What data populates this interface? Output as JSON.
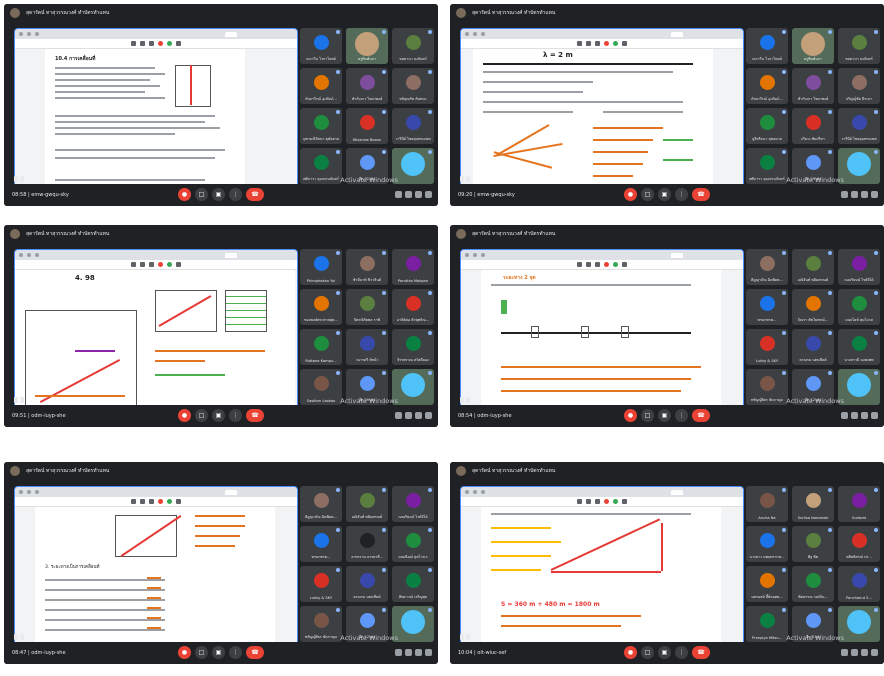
{
  "window_title": "สุดารัตน์ ทาสุวรรณวงศ์ ทำบัตรทำแทน",
  "activate": {
    "title": "Activate Windows",
    "subtitle": "Go to Settings to activate Windows."
  },
  "panels": [
    {
      "meeting_time": "08:58",
      "meeting_code": "emw-gwqu-sky",
      "participants": [
        {
          "name": "ณราวีน ไวกาโพลย์",
          "color": "#1a73e8"
        },
        {
          "name": "ครูพิมพ์นภา",
          "color": "#c4a07a",
          "video": true
        },
        {
          "name": "ชลดานา ธงจันทร์",
          "color": "#5b7f3e"
        },
        {
          "name": "กัลยาวีรณ์ อุปถัมภ์...",
          "color": "#e37400"
        },
        {
          "name": "ทำกับเกว ไชยาพงษ์",
          "color": "#7f4d9e"
        },
        {
          "name": "ชนิตุณรัช ตันทนะ",
          "color": "#8d6e63"
        },
        {
          "name": "จุฑามณีรัตนา ตุฬอตาม",
          "color": "#1e8e3e"
        },
        {
          "name": "Wivarrae Boonu",
          "color": "#d93025"
        },
        {
          "name": "วารีนีย์ ไชยสุนทรมเขต",
          "color": "#3949ab"
        },
        {
          "name": "ศศิภารา ลุมเหรนจันทร์",
          "color": "#0b8043"
        },
        {
          "name": "อีก 31 คน",
          "color": "#5e97f6"
        },
        {
          "name": "",
          "color": "#4fc3f7",
          "video": true
        }
      ]
    },
    {
      "meeting_time": "09:20",
      "meeting_code": "emw-gwqu-sky",
      "participants": [
        {
          "name": "ณราวีน ไวกาโพลย์",
          "color": "#1a73e8"
        },
        {
          "name": "ครูพิมพ์นภา",
          "color": "#c4a07a",
          "video": true
        },
        {
          "name": "ชลดานา ธงจันทร์",
          "color": "#5b7f3e"
        },
        {
          "name": "กัลยาวีรณ์ อุปถัมภ์...",
          "color": "#e37400"
        },
        {
          "name": "ทำกับเกว ไชยาพงษ์",
          "color": "#7f4d9e"
        },
        {
          "name": "ปริญญ์ชัย ธีระลา",
          "color": "#8d6e63"
        },
        {
          "name": "นูรีตรีมนา สุขลดาม",
          "color": "#1e8e3e"
        },
        {
          "name": "เกียวง ชัยปรีชา",
          "color": "#d93025"
        },
        {
          "name": "วารีนีย์ ไชยสุนทรมเขต",
          "color": "#3949ab"
        },
        {
          "name": "ศศิภารา ลุมเหรนจันทร์",
          "color": "#0b8043"
        },
        {
          "name": "อีก 29 คน",
          "color": "#5e97f6"
        },
        {
          "name": "",
          "color": "#4fc3f7",
          "video": true
        }
      ]
    },
    {
      "meeting_time": "09:51",
      "meeting_code": "odm-iuyp-she",
      "participants": [
        {
          "name": "Phimphakan Yui",
          "color": "#1a73e8"
        },
        {
          "name": "ชำมีนาท์ ชีวาลินต์",
          "color": "#8d6e63"
        },
        {
          "name": "Pornthia Makpan",
          "color": "#7b1fa2"
        },
        {
          "name": "ทองพงษ์พระทาสสุต...",
          "color": "#e37400"
        },
        {
          "name": "จิตรณิรัตพล ราชิ",
          "color": "#5b7f3e"
        },
        {
          "name": "อาจิต์ต่อ ตัวพุทธิณ...",
          "color": "#d93025"
        },
        {
          "name": "Ruttana Kampu...",
          "color": "#1e8e3e"
        },
        {
          "name": "วนารดรี ต์ชน้า",
          "color": "#3949ab"
        },
        {
          "name": "จิรรพรวณ สวัสดีลอง",
          "color": "#0b8043"
        },
        {
          "name": "Sasiforn Laokoo",
          "color": "#795548"
        },
        {
          "name": "อีก 29 คน",
          "color": "#5e97f6"
        },
        {
          "name": "",
          "color": "#4fc3f7",
          "video": true
        }
      ]
    },
    {
      "meeting_time": "08:54",
      "meeting_code": "odm-iuyp-she",
      "participants": [
        {
          "name": "ศิฎญาภัณ ฉิดพิดต...",
          "color": "#8d6e63"
        },
        {
          "name": "อณิจันท์ พลิมศรณต์",
          "color": "#5b7f3e"
        },
        {
          "name": "ณณริษมน์ ไรต์จิได์",
          "color": "#7b1fa2"
        },
        {
          "name": "ทรมกทรต...",
          "color": "#1a73e8"
        },
        {
          "name": "จิณรา ตัชโยพรณ์...",
          "color": "#e37400"
        },
        {
          "name": "มนธไดช์ สุมโจวส",
          "color": "#1e8e3e"
        },
        {
          "name": "Lukky & SKY",
          "color": "#d93025"
        },
        {
          "name": "ธรณรม นตนชีดต์",
          "color": "#3949ab"
        },
        {
          "name": "นางสาวนี นงพงพพ",
          "color": "#0b8043"
        },
        {
          "name": "ทรัญญ์ศิยร ขัดกาญจ",
          "color": "#795548"
        },
        {
          "name": "อีก 12 คน",
          "color": "#5e97f6"
        },
        {
          "name": "",
          "color": "#4fc3f7",
          "video": true
        }
      ]
    },
    {
      "meeting_time": "08:47",
      "meeting_code": "odm-iuyp-she",
      "participants": [
        {
          "name": "ศิฎญาภัณ ฉิดพิดต...",
          "color": "#8d6e63"
        },
        {
          "name": "อณิจันท์ พลิมศรณต์",
          "color": "#5b7f3e"
        },
        {
          "name": "ณณริษมน์ ไรต์จิได์",
          "color": "#7b1fa2"
        },
        {
          "name": "ทรมกทรต...",
          "color": "#1a73e8"
        },
        {
          "name": "อาทรราม ธรรดรสี...",
          "color": "#202124"
        },
        {
          "name": "มณณียณ์ สุตโวรเร",
          "color": "#1e8e3e"
        },
        {
          "name": "Lukky & SKY",
          "color": "#d93025"
        },
        {
          "name": "ธรณรม นตนชีดต์",
          "color": "#3949ab"
        },
        {
          "name": "สิทธาวณ์ เจริญสุข",
          "color": "#0b8043"
        },
        {
          "name": "ทรัญญ์ศิยร ขัดกาญจ",
          "color": "#795548"
        },
        {
          "name": "อีก 12 คน",
          "color": "#5e97f6"
        },
        {
          "name": "",
          "color": "#4fc3f7",
          "video": true
        }
      ]
    },
    {
      "meeting_time": "10:04",
      "meeting_code": "oit-wiuc-sef",
      "participants": [
        {
          "name": "Ancha Na",
          "color": "#795548"
        },
        {
          "name": "Suriisa Namanak",
          "color": "#c4a07a"
        },
        {
          "name": "Sudarat",
          "color": "#7b1fa2"
        },
        {
          "name": "นางสาว นพฤทรากช...",
          "color": "#1a73e8"
        },
        {
          "name": "พิฐ พิต",
          "color": "#5b7f3e"
        },
        {
          "name": "พสิษติสรณ์ ปร...",
          "color": "#d93025"
        },
        {
          "name": "นทรอลท์ ลี้ต์ลอศต...",
          "color": "#e37400"
        },
        {
          "name": "พิมตรรณ รงต์จัน...",
          "color": "#1e8e3e"
        },
        {
          "name": "Panchanut S...",
          "color": "#3949ab"
        },
        {
          "name": "Pranpiya Mitsu...",
          "color": "#0b8043"
        },
        {
          "name": "อีก 8 คน",
          "color": "#5e97f6"
        },
        {
          "name": "",
          "color": "#4fc3f7",
          "video": true
        }
      ]
    }
  ],
  "slides": {
    "p1_title": "10.4 การเคลื่อนที่",
    "p2_title": "λ = 2 m",
    "p3_title": "4.  98",
    "p4_title": "ระยะทาง 2 จุด",
    "p5_title": "3. ระยะทางเป็นการเคลื่อนที่",
    "p6_title": "S = 360 m + 480 m = 1800 m"
  }
}
